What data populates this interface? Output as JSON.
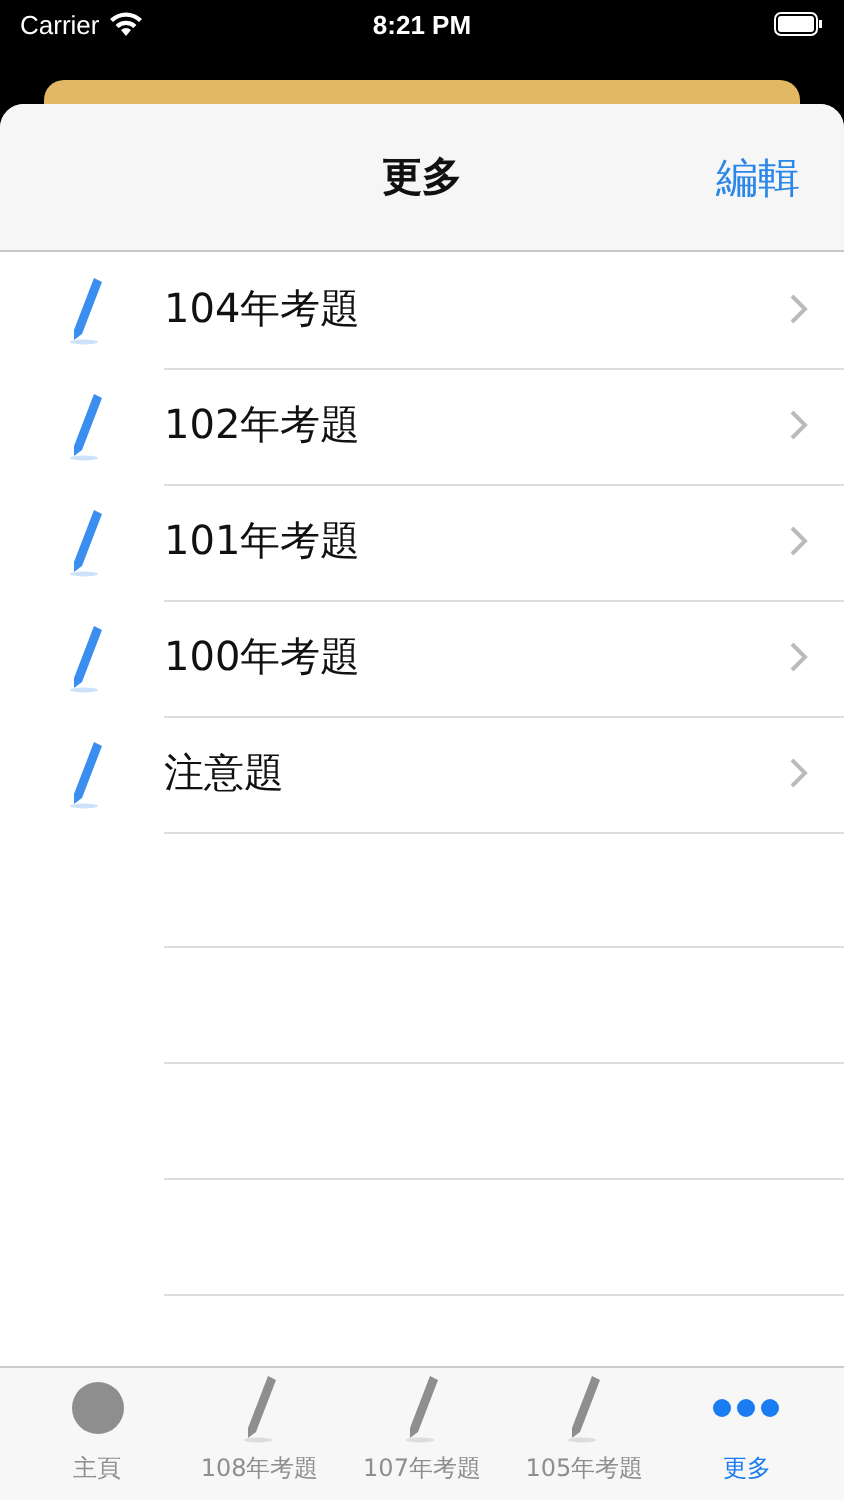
{
  "status_bar": {
    "carrier": "Carrier",
    "time": "8:21 PM"
  },
  "nav": {
    "title": "更多",
    "edit": "編輯"
  },
  "rows": [
    {
      "label": "104年考題"
    },
    {
      "label": "102年考題"
    },
    {
      "label": "101年考題"
    },
    {
      "label": "100年考題"
    },
    {
      "label": "注意題"
    }
  ],
  "tabs": [
    {
      "label": "主頁",
      "kind": "circle",
      "selected": false
    },
    {
      "label": "108年考題",
      "kind": "pencil",
      "selected": false
    },
    {
      "label": "107年考題",
      "kind": "pencil",
      "selected": false
    },
    {
      "label": "105年考題",
      "kind": "pencil",
      "selected": false
    },
    {
      "label": "更多",
      "kind": "dots",
      "selected": true
    }
  ]
}
